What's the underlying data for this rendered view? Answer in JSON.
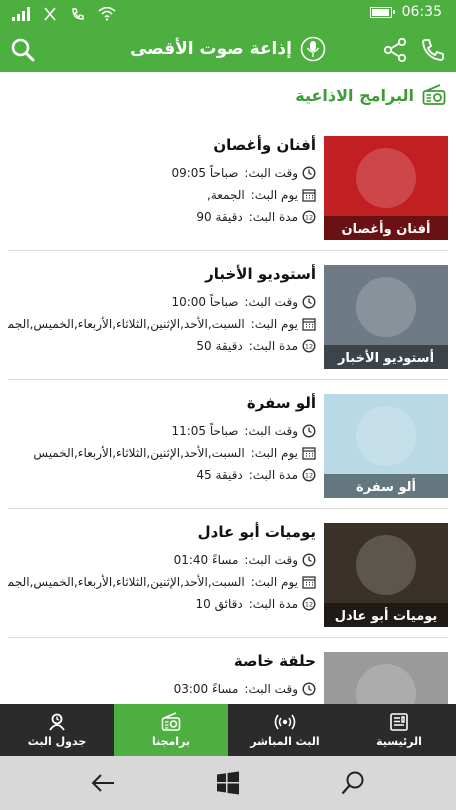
{
  "status": {
    "time": "06:35"
  },
  "header": {
    "title": "إذاعة صوت الأقصى"
  },
  "section": {
    "title": "البرامج الاذاعية"
  },
  "labels": {
    "time": "وقت البث:",
    "day": "يوم البث:",
    "duration": "مدة البث:"
  },
  "programs": [
    {
      "name": "أفنان وأغصان",
      "time": "صباحاً 09:05",
      "days": "الجمعة,",
      "duration": "دقيقة 90",
      "thumb_text": "أفنان وأغصان",
      "thumb_color": "#c21f23"
    },
    {
      "name": "أستوديو الأخبار",
      "time": "صباحاً 10:00",
      "days": "السبت,الأحد,الإثنين,الثلاثاء,الأربعاء,الخميس,الجمعة",
      "duration": "دقيقة 50",
      "thumb_text": "أستوديو الأخبار",
      "thumb_color": "#6e7a86"
    },
    {
      "name": "ألو سفرة",
      "time": "صباحاً 11:05",
      "days": "السبت,الأحد,الإثنين,الثلاثاء,الأربعاء,الخميس",
      "duration": "دقيقة 45",
      "thumb_text": "ألو سفرة",
      "thumb_color": "#b9d9e6"
    },
    {
      "name": "يوميات أبو عادل",
      "time": "مساءً 01:40",
      "days": "السبت,الأحد,الإثنين,الثلاثاء,الأربعاء,الخميس,الجمعة",
      "duration": "دقائق 10",
      "thumb_text": "يوميات أبو عادل",
      "thumb_color": "#3a3128"
    },
    {
      "name": "حلقة خاصة",
      "time": "مساءً 03:00",
      "days": "",
      "duration": "",
      "thumb_text": "",
      "thumb_color": "#9a9a9a"
    }
  ],
  "nav": [
    {
      "label": "الرئيسية",
      "icon": "home-icon",
      "active": false
    },
    {
      "label": "البث المباشر",
      "icon": "broadcast-icon",
      "active": false
    },
    {
      "label": "برامجنا",
      "icon": "radio-icon",
      "active": true
    },
    {
      "label": "جدول البث",
      "icon": "schedule-icon",
      "active": false
    }
  ],
  "colors": {
    "primary": "#4caf40",
    "section": "#3d9c35",
    "nav_bg": "#2b2b2b"
  }
}
